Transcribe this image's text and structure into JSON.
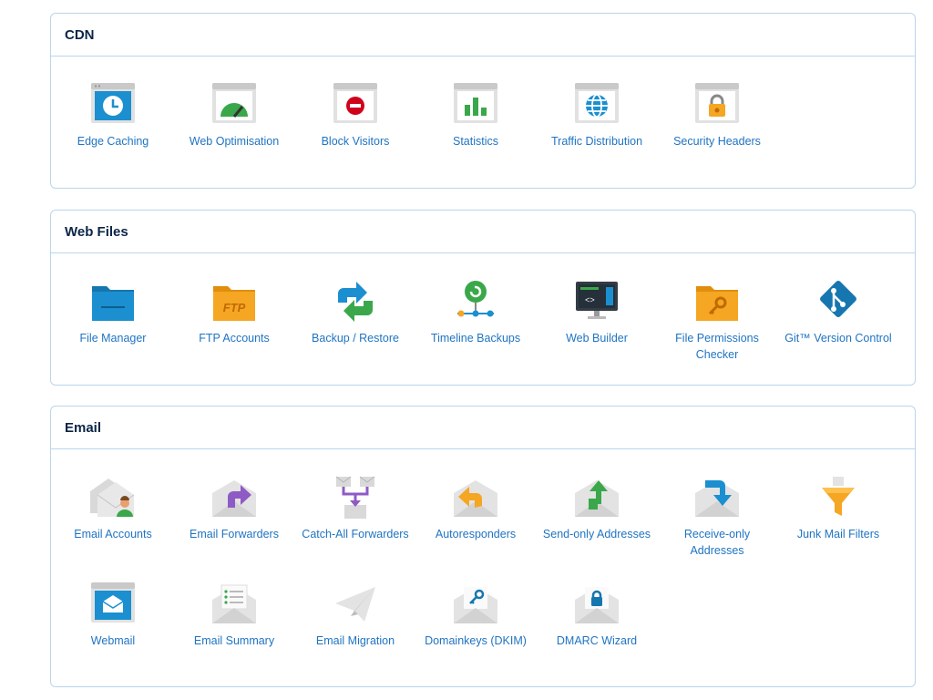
{
  "sections": [
    {
      "title": "CDN",
      "items": [
        {
          "label": "Edge Caching",
          "icon": "clock-window-icon"
        },
        {
          "label": "Web Optimisation",
          "icon": "gauge-window-icon"
        },
        {
          "label": "Block Visitors",
          "icon": "block-window-icon"
        },
        {
          "label": "Statistics",
          "icon": "bar-chart-window-icon"
        },
        {
          "label": "Traffic Distribution",
          "icon": "globe-window-icon"
        },
        {
          "label": "Security Headers",
          "icon": "padlock-window-icon"
        }
      ]
    },
    {
      "title": "Web Files",
      "items": [
        {
          "label": "File Manager",
          "icon": "blue-folder-icon"
        },
        {
          "label": "FTP Accounts",
          "icon": "ftp-folder-icon"
        },
        {
          "label": "Backup / Restore",
          "icon": "backup-restore-icon"
        },
        {
          "label": "Timeline Backups",
          "icon": "timeline-icon"
        },
        {
          "label": "Web Builder",
          "icon": "monitor-builder-icon"
        },
        {
          "label": "File Permissions Checker",
          "icon": "key-folder-icon"
        },
        {
          "label": "Git™ Version Control",
          "icon": "git-icon"
        }
      ]
    },
    {
      "title": "Email",
      "items": [
        {
          "label": "Email Accounts",
          "icon": "envelopes-person-icon"
        },
        {
          "label": "Email Forwarders",
          "icon": "envelope-forward-icon"
        },
        {
          "label": "Catch-All Forwarders",
          "icon": "envelope-merge-icon"
        },
        {
          "label": "Autoresponders",
          "icon": "envelope-reply-icon"
        },
        {
          "label": "Send-only Addresses",
          "icon": "envelope-send-icon"
        },
        {
          "label": "Receive-only Addresses",
          "icon": "envelope-receive-icon"
        },
        {
          "label": "Junk Mail Filters",
          "icon": "funnel-icon"
        },
        {
          "label": "Webmail",
          "icon": "webmail-window-icon"
        },
        {
          "label": "Email Summary",
          "icon": "envelope-list-icon"
        },
        {
          "label": "Email Migration",
          "icon": "paper-plane-icon"
        },
        {
          "label": "Domainkeys (DKIM)",
          "icon": "envelope-key-icon"
        },
        {
          "label": "DMARC Wizard",
          "icon": "envelope-lock-icon"
        }
      ]
    }
  ],
  "colors": {
    "title": "#0b2547",
    "label": "#1f74c2",
    "border": "#b9d6ee",
    "blue": "#1b8fd0",
    "orange": "#f5a623",
    "green": "#3aa84a"
  }
}
